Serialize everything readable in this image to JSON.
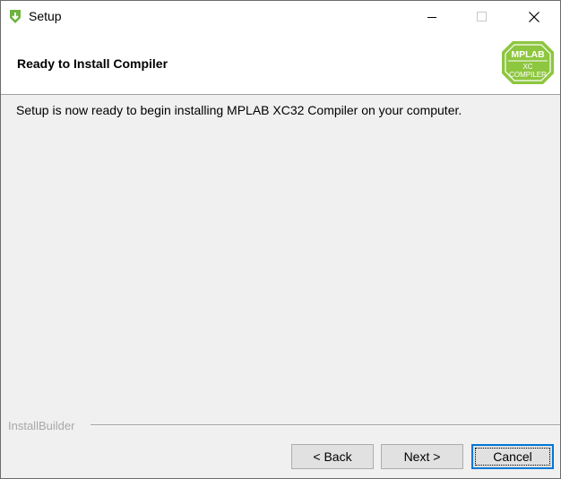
{
  "window": {
    "title": "Setup",
    "controls": {
      "minimize": "minimize-icon",
      "maximize": "maximize-icon",
      "close": "close-icon"
    }
  },
  "header": {
    "title": "Ready to Install Compiler",
    "logo": {
      "line1": "MPLAB",
      "line2": "XC",
      "line3": "COMPILER",
      "color": "#8dc63f"
    }
  },
  "main": {
    "message": "Setup is now ready to begin installing MPLAB XC32 Compiler on your computer."
  },
  "footer": {
    "brand": "InstallBuilder"
  },
  "buttons": {
    "back": "< Back",
    "next": "Next >",
    "cancel": "Cancel"
  },
  "colors": {
    "accent": "#0078d7",
    "app_icon": "#6db33f"
  }
}
